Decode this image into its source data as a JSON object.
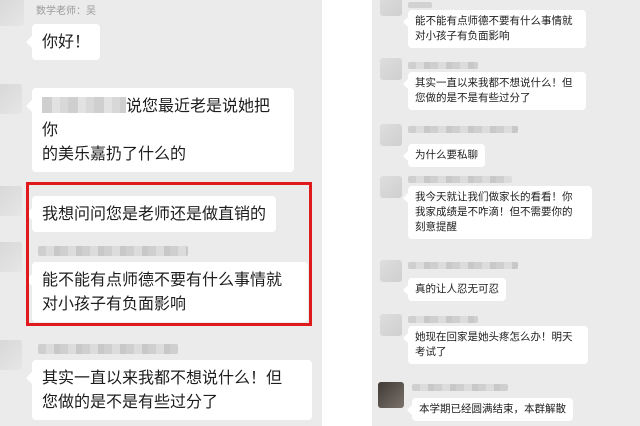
{
  "left_chat": {
    "sender_label": "数学老师：吴",
    "messages": [
      {
        "text": "你好！"
      },
      {
        "line1_suffix": "说您最近老是说她把你",
        "line2": "的美乐嘉扔了什么的"
      },
      {
        "text": "我想问问您是老师还是做直销的"
      },
      {
        "line1": "能不能有点师德不要有什么事情就",
        "line2": "对小孩子有负面影响"
      },
      {
        "line1": "其实一直以来我都不想说什么！但",
        "line2": "您做的是不是有些过分了"
      }
    ]
  },
  "right_chat": {
    "messages": [
      {
        "line1": "能不能有点师德不要有什么事情就",
        "line2": "对小孩子有负面影响"
      },
      {
        "line1": "其实一直以来我都不想说什么！但",
        "line2": "您做的是不是有些过分了"
      },
      {
        "text": "为什么要私聊"
      },
      {
        "line1": "我今天就让我们做家长的看看！你",
        "line2": "我家成绩是不咋滴！但不需要你的",
        "line3": "刻意提醒"
      },
      {
        "text": "真的让人忍无可忍"
      },
      {
        "line1": "她现在回家是她头疼怎么办！明天",
        "line2": "考试了"
      },
      {
        "text": "本学期已经圆满结束，本群解散"
      }
    ]
  },
  "colors": {
    "chat_background": "#ebebeb",
    "bubble": "#ffffff",
    "highlight": "#e0191c"
  }
}
